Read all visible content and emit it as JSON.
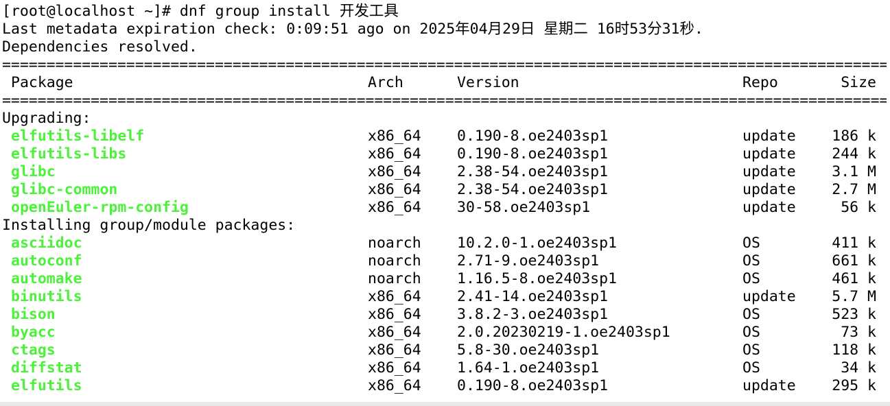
{
  "terminal": {
    "prompt": "[root@localhost ~]# dnf group install 开发工具",
    "metadata_line": "Last metadata expiration check: 0:09:51 ago on 2025年04月29日 星期二 16时53分31秒.",
    "deps_line": "Dependencies resolved.",
    "separator": "====================================================================================================",
    "header": {
      "package": "Package",
      "arch": "Arch",
      "version": "Version",
      "repo": "Repo",
      "size": "Size"
    },
    "sections": [
      {
        "title": "Upgrading:",
        "rows": [
          {
            "package": "elfutils-libelf",
            "arch": "x86_64",
            "version": "0.190-8.oe2403sp1",
            "repo": "update",
            "size": "186 k"
          },
          {
            "package": "elfutils-libs",
            "arch": "x86_64",
            "version": "0.190-8.oe2403sp1",
            "repo": "update",
            "size": "244 k"
          },
          {
            "package": "glibc",
            "arch": "x86_64",
            "version": "2.38-54.oe2403sp1",
            "repo": "update",
            "size": "3.1 M"
          },
          {
            "package": "glibc-common",
            "arch": "x86_64",
            "version": "2.38-54.oe2403sp1",
            "repo": "update",
            "size": "2.7 M"
          },
          {
            "package": "openEuler-rpm-config",
            "arch": "x86_64",
            "version": "30-58.oe2403sp1",
            "repo": "update",
            "size": "56 k"
          }
        ]
      },
      {
        "title": "Installing group/module packages:",
        "rows": [
          {
            "package": "asciidoc",
            "arch": "noarch",
            "version": "10.2.0-1.oe2403sp1",
            "repo": "OS",
            "size": "411 k"
          },
          {
            "package": "autoconf",
            "arch": "noarch",
            "version": "2.71-9.oe2403sp1",
            "repo": "OS",
            "size": "661 k"
          },
          {
            "package": "automake",
            "arch": "noarch",
            "version": "1.16.5-8.oe2403sp1",
            "repo": "OS",
            "size": "461 k"
          },
          {
            "package": "binutils",
            "arch": "x86_64",
            "version": "2.41-14.oe2403sp1",
            "repo": "update",
            "size": "5.7 M"
          },
          {
            "package": "bison",
            "arch": "x86_64",
            "version": "3.8.2-3.oe2403sp1",
            "repo": "OS",
            "size": "523 k"
          },
          {
            "package": "byacc",
            "arch": "x86_64",
            "version": "2.0.20230219-1.oe2403sp1",
            "repo": "OS",
            "size": "73 k"
          },
          {
            "package": "ctags",
            "arch": "x86_64",
            "version": "5.8-30.oe2403sp1",
            "repo": "OS",
            "size": "118 k"
          },
          {
            "package": "diffstat",
            "arch": "x86_64",
            "version": "1.64-1.oe2403sp1",
            "repo": "OS",
            "size": "34 k"
          },
          {
            "package": "elfutils",
            "arch": "x86_64",
            "version": "0.190-8.oe2403sp1",
            "repo": "update",
            "size": "295 k"
          }
        ]
      }
    ]
  }
}
